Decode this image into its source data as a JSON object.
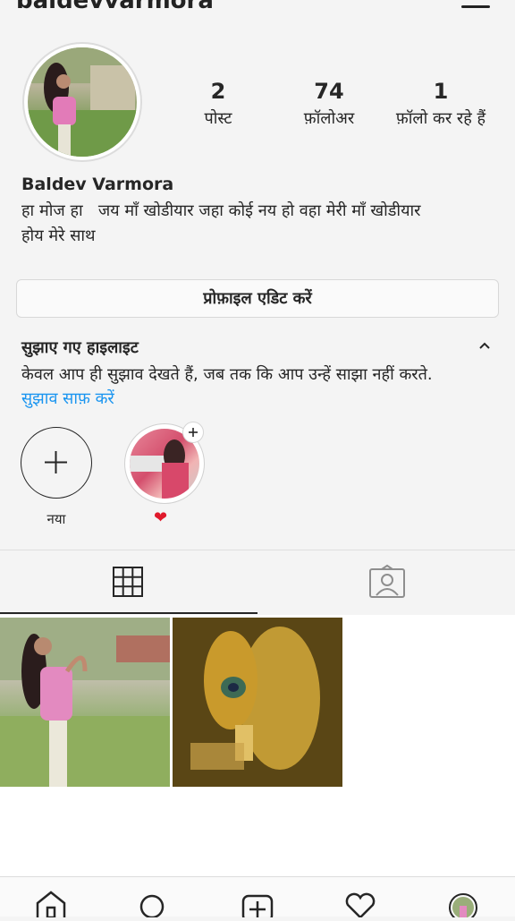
{
  "header": {
    "username": "baldevvarmora"
  },
  "profile": {
    "stats": [
      {
        "value": "2",
        "label": "पोस्ट"
      },
      {
        "value": "74",
        "label": "फ़ॉलोअर"
      },
      {
        "value": "1",
        "label": "फ़ॉलो कर रहे हैं"
      }
    ],
    "name": "Baldev Varmora",
    "bio_line1": "हा मोज हा   जय माँ खोडीयार जहा कोई नय हो वहा मेरी माँ खोडीयार",
    "bio_line2": "होय मेरे साथ",
    "edit_button": "प्रोफ़ाइल एडिट करें"
  },
  "highlights": {
    "title": "सुझाए गए हाइलाइट",
    "description": "केवल आप ही सुझाव देखते हैं, जब तक कि आप उन्हें साझा नहीं करते.",
    "clear_link": "सुझाव साफ़ करें",
    "new_label": "नया",
    "suggested_label_icon": "heart-icon"
  },
  "colors": {
    "link": "#1a95f0",
    "heart": "#e0192b",
    "text": "#262626"
  },
  "icons": {
    "tabs": [
      "grid-icon",
      "tagged-icon"
    ],
    "bottom_nav": [
      "home-icon",
      "search-icon",
      "add-post-icon",
      "activity-heart-icon",
      "profile-avatar"
    ]
  }
}
